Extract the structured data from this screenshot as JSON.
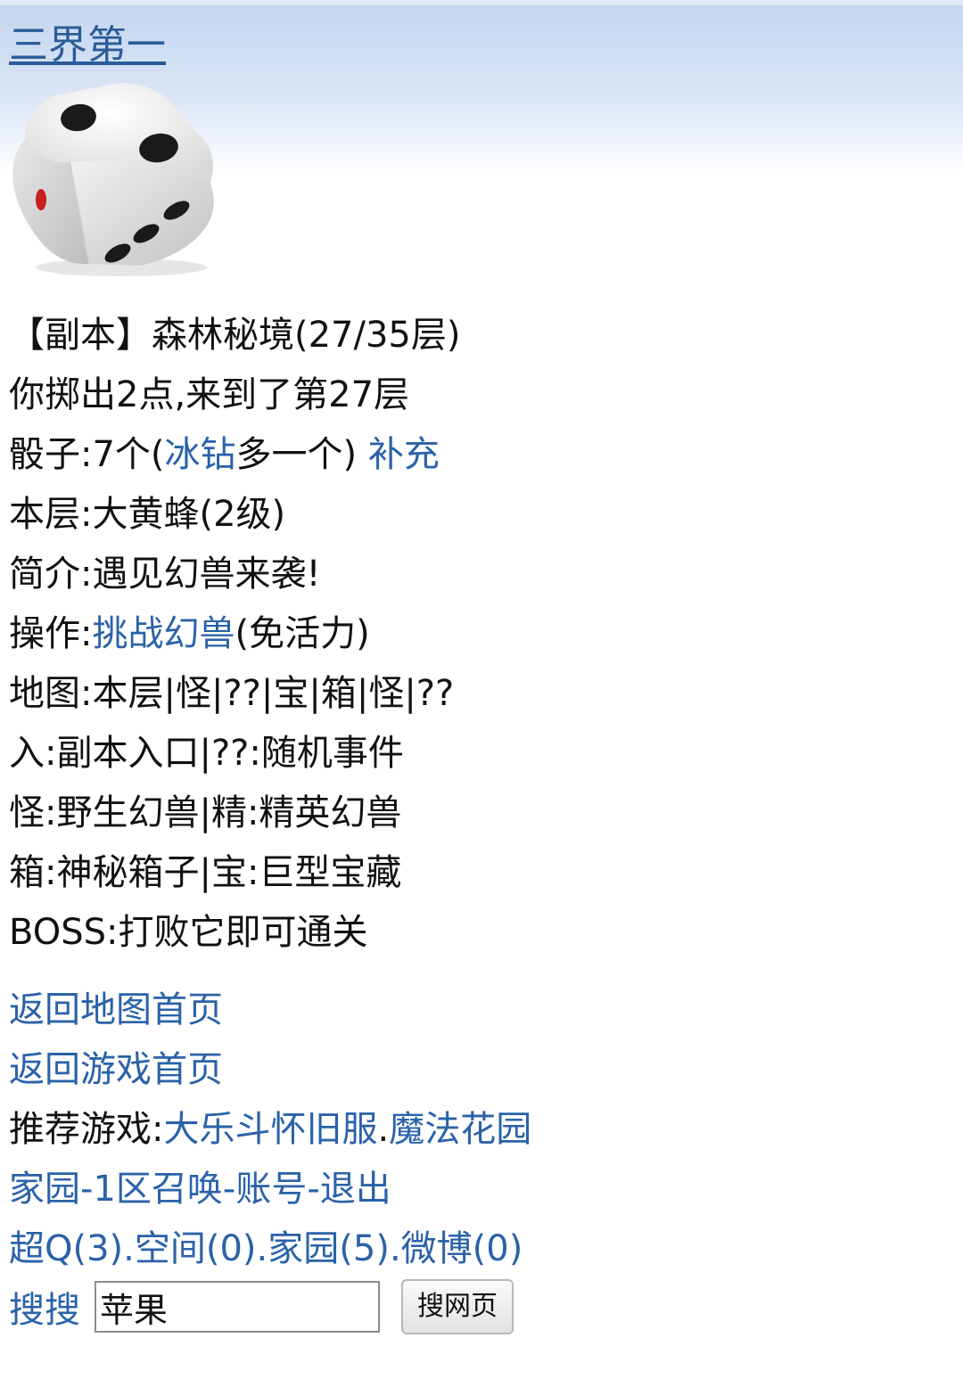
{
  "header": {
    "site_title": "三界第一"
  },
  "dice_image": {
    "icon": "dice-icon",
    "face_top_pips": 2,
    "face_front_pips": 3,
    "face_left_pips": 1
  },
  "info": {
    "dungeon_line": "【副本】森林秘境(27/35层)",
    "roll_line": "你掷出2点,来到了第27层",
    "dice_prefix": "骰子:7个(",
    "dice_link": "冰钻",
    "dice_suffix": "多一个) ",
    "refill_link": "补充",
    "floor_line": "本层:大黄蜂(2级)",
    "intro_line": "简介:遇见幻兽来袭!",
    "action_prefix": "操作:",
    "action_link": "挑战幻兽",
    "action_suffix": "(免活力)",
    "map_line": "地图:本层|怪|??|宝|箱|怪|??",
    "legend_1": "入:副本入口|??:随机事件",
    "legend_2": "怪:野生幻兽|精:精英幻兽",
    "legend_3": "箱:神秘箱子|宝:巨型宝藏",
    "legend_4": "BOSS:打败它即可通关"
  },
  "nav": {
    "back_map": "返回地图首页",
    "back_game": "返回游戏首页",
    "recommend_prefix": "推荐游戏:",
    "recommend_game_1": "大乐斗怀旧服",
    "recommend_sep": ".",
    "recommend_game_2": "魔法花园",
    "home": "家园",
    "dash": "-",
    "zone": "1区召唤",
    "account": "账号",
    "logout": "退出",
    "superq": "超Q(3)",
    "dot": ".",
    "space": "空间(0)",
    "homeland": "家园(5)",
    "weibo": "微博(0)"
  },
  "search": {
    "label": "搜搜",
    "value": "苹果",
    "button": "搜网页"
  }
}
